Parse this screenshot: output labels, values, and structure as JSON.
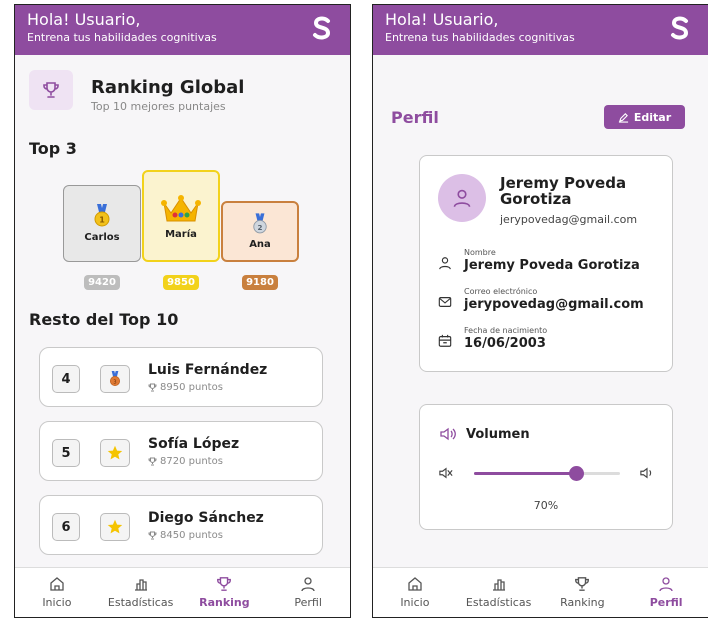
{
  "header": {
    "greeting": "Hola! Usuario,",
    "subtitle": "Entrena tus habilidades cognitivas"
  },
  "ranking": {
    "title": "Ranking Global",
    "subtitle": "Top 10 mejores puntajes",
    "top3_title": "Top 3",
    "rest_title": "Resto del Top 10",
    "podium": [
      {
        "name": "Carlos",
        "score": "9420",
        "place": 2,
        "medal": "gold-medal-icon"
      },
      {
        "name": "María",
        "score": "9850",
        "place": 1,
        "medal": "crown-icon"
      },
      {
        "name": "Ana",
        "score": "9180",
        "place": 3,
        "medal": "silver-medal-icon"
      }
    ],
    "list": [
      {
        "pos": "4",
        "name": "Luis Fernández",
        "points": "8950 puntos",
        "badge": "bronze-medal-icon"
      },
      {
        "pos": "5",
        "name": "Sofía López",
        "points": "8720 puntos",
        "badge": "star-icon"
      },
      {
        "pos": "6",
        "name": "Diego Sánchez",
        "points": "8450 puntos",
        "badge": "star-icon"
      }
    ]
  },
  "nav": {
    "items": [
      {
        "label": "Inicio",
        "icon": "home-icon"
      },
      {
        "label": "Estadísticas",
        "icon": "chart-icon"
      },
      {
        "label": "Ranking",
        "icon": "trophy-icon"
      },
      {
        "label": "Perfil",
        "icon": "user-icon"
      }
    ],
    "left_active": "Ranking",
    "right_active": "Perfil"
  },
  "profile": {
    "title": "Perfil",
    "edit_label": "Editar",
    "name": "Jeremy Poveda Gorotiza",
    "email": "jerypovedag@gmail.com",
    "fields": [
      {
        "label": "Nombre",
        "value": "Jeremy Poveda Gorotiza",
        "icon": "user-icon"
      },
      {
        "label": "Correo electrónico",
        "value": "jerypovedag@gmail.com",
        "icon": "mail-icon"
      },
      {
        "label": "Fecha de nacimiento",
        "value": "16/06/2003",
        "icon": "calendar-icon"
      }
    ]
  },
  "volume": {
    "title": "Volumen",
    "level": 0.7,
    "percent_label": "70%"
  },
  "colors": {
    "brand": "#8e4c9f",
    "gold": "#f2d21b",
    "silver": "#bdbdbd",
    "bronze": "#c9803e"
  }
}
